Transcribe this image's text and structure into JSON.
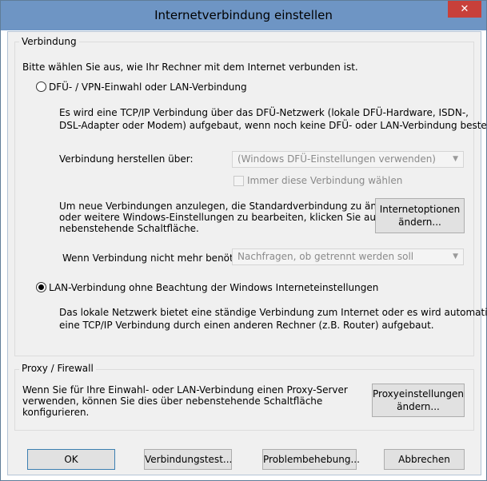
{
  "window": {
    "title": "Internetverbindung einstellen",
    "close_glyph": "✕"
  },
  "verbindung": {
    "group_label": "Verbindung",
    "intro": "Bitte wählen Sie aus, wie Ihr Rechner mit dem Internet verbunden ist.",
    "option_dfue": {
      "label": "DFÜ- / VPN-Einwahl oder LAN-Verbindung",
      "selected": false,
      "desc_line1": "Es wird eine TCP/IP Verbindung über das DFÜ-Netzwerk (lokale DFÜ-Hardware, ISDN-,",
      "desc_line2": "DSL-Adapter oder Modem) aufgebaut, wenn noch keine DFÜ- oder LAN-Verbindung besteht."
    },
    "herstellen_label": "Verbindung herstellen über:",
    "herstellen_value": "(Windows DFÜ-Einstellungen verwenden)",
    "immer_label": "Immer diese Verbindung wählen",
    "neue_line1": "Um neue Verbindungen anzulegen, die Standardverbindung zu ändern",
    "neue_line2": "oder weitere Windows-Einstellungen zu bearbeiten, klicken Sie auf",
    "neue_line3": "nebenstehende Schaltfläche.",
    "internetoptionen_line1": "Internetoptionen",
    "internetoptionen_line2": "ändern...",
    "nicht_benoetigt_label": "Wenn Verbindung nicht mehr benötigt:",
    "nicht_benoetigt_value": "Nachfragen, ob getrennt werden soll",
    "option_lan": {
      "label": "LAN-Verbindung ohne Beachtung der Windows Interneteinstellungen",
      "selected": true,
      "desc_line1": "Das lokale Netzwerk bietet eine ständige Verbindung zum Internet oder es wird automatisch",
      "desc_line2": "eine TCP/IP Verbindung durch einen anderen Rechner (z.B. Router) aufgebaut."
    }
  },
  "proxy": {
    "group_label": "Proxy / Firewall",
    "line1": "Wenn Sie für Ihre Einwahl- oder LAN-Verbindung einen Proxy-Server",
    "line2": "verwenden, können Sie dies über nebenstehende Schaltfläche",
    "line3": "konfigurieren.",
    "button_line1": "Proxyeinstellungen",
    "button_line2": "ändern..."
  },
  "footer": {
    "ok": "OK",
    "test": "Verbindungstest...",
    "problem": "Problembehebung...",
    "cancel": "Abbrechen"
  }
}
